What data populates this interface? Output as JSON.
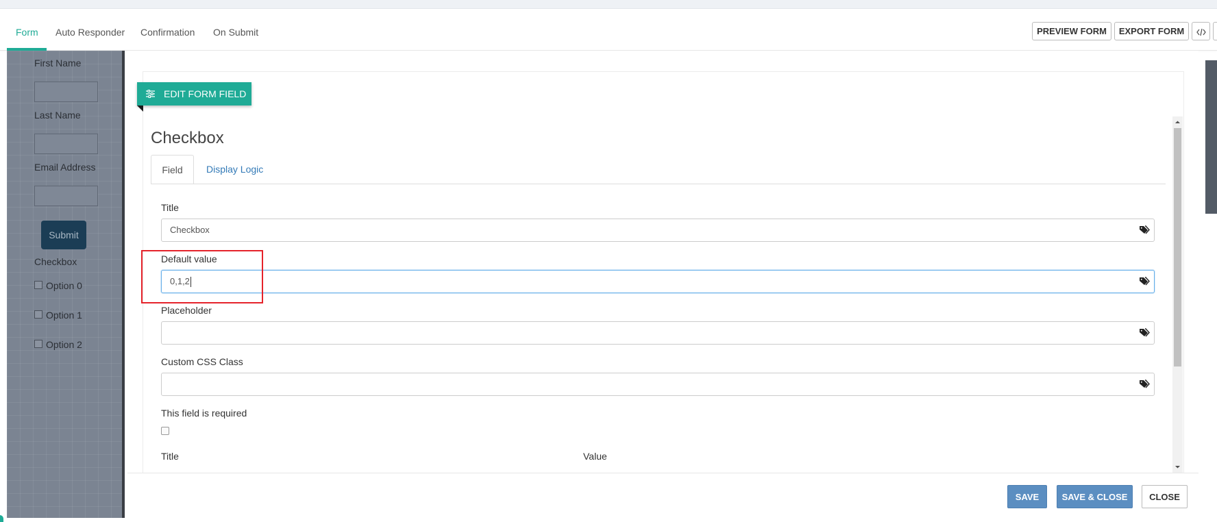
{
  "nav": {
    "tabs": [
      {
        "label": "Form",
        "active": true
      },
      {
        "label": "Auto Responder",
        "active": false
      },
      {
        "label": "Confirmation",
        "active": false
      },
      {
        "label": "On Submit",
        "active": false
      }
    ],
    "actions": {
      "preview": "PREVIEW FORM",
      "export": "EXPORT FORM",
      "embed_icon": "code-icon"
    }
  },
  "preview": {
    "first_name": "First Name",
    "last_name": "Last Name",
    "email": "Email Address",
    "submit": "Submit",
    "checkbox_label": "Checkbox",
    "options": [
      "Option 0",
      "Option 1",
      "Option 2"
    ]
  },
  "editor": {
    "badge": "EDIT FORM FIELD",
    "badge_icon": "sliders-icon",
    "field_type": "Checkbox",
    "tabs": {
      "field": "Field",
      "logic": "Display Logic"
    },
    "fields": {
      "title": {
        "label": "Title",
        "value": "Checkbox"
      },
      "default_value": {
        "label": "Default value",
        "value": "0,1,2"
      },
      "placeholder": {
        "label": "Placeholder",
        "value": ""
      },
      "css_class": {
        "label": "Custom CSS Class",
        "value": ""
      }
    },
    "required_label": "This field is required",
    "required_checked": false,
    "options_table": {
      "col_title": "Title",
      "col_value": "Value"
    },
    "tag_icon": "tags-icon"
  },
  "footer": {
    "save": "SAVE",
    "save_close": "SAVE & CLOSE",
    "close": "CLOSE"
  },
  "colors": {
    "accent": "#1fab96",
    "primary_button": "#5b8ec1",
    "highlight": "#e5222a",
    "link": "#337ab7"
  }
}
